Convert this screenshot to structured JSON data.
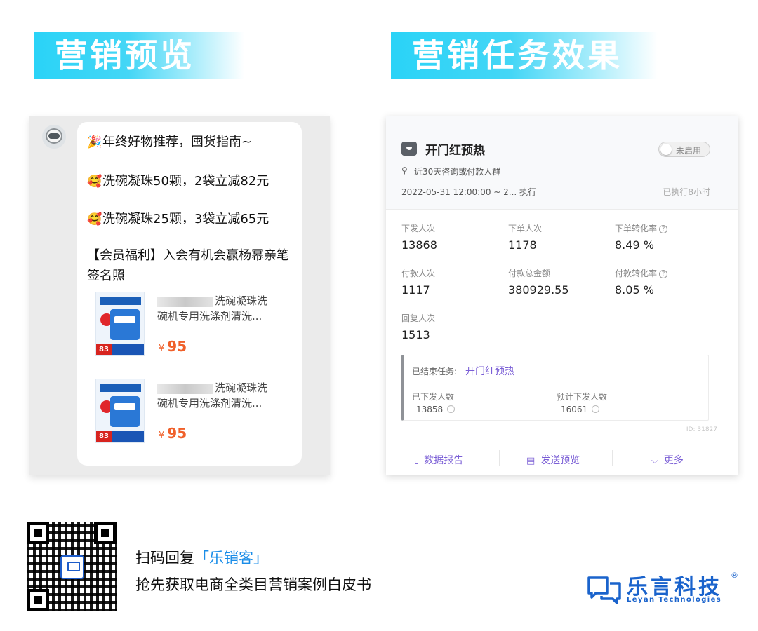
{
  "banners": {
    "left": "营销预览",
    "right": "营销任务效果"
  },
  "chat": {
    "line1_emoji": "🎉",
    "line1": "年终好物推荐，囤货指南~",
    "line2_emoji": "🥰",
    "line2": "洗碗凝珠50颗，2袋立减82元",
    "line3_emoji": "🥰",
    "line3": "洗碗凝珠25颗，3袋立减65元",
    "benefit": "【会员福利】入会有机会赢杨幂亲笔签名照",
    "products": [
      {
        "title_line1": "洗碗凝珠洗",
        "title_line2": "碗机专用洗涤剂清洗...",
        "currency": "¥",
        "price": "95",
        "thumb_tag": "83"
      },
      {
        "title_line1": "洗碗凝珠洗",
        "title_line2": "碗机专用洗涤剂清洗...",
        "currency": "¥",
        "price": "95",
        "thumb_tag": "83"
      }
    ]
  },
  "task": {
    "title": "开门红预热",
    "toggle_label": "未启用",
    "audience": "近30天咨询或付款人群",
    "time_range": "2022-05-31 12:00:00 ~ 2... 执行",
    "executed": "已执行8小时",
    "stats": {
      "sent_label": "下发人次",
      "sent_value": "13868",
      "orders_label": "下单人次",
      "orders_value": "1178",
      "order_rate_label": "下单转化率",
      "order_rate_value": "8.49 %",
      "paid_label": "付款人次",
      "paid_value": "1117",
      "paid_amount_label": "付款总金额",
      "paid_amount_value": "380929.55",
      "pay_rate_label": "付款转化率",
      "pay_rate_value": "8.05 %",
      "reply_label": "回复人次",
      "reply_value": "1513"
    },
    "ended": {
      "label": "已结束任务:",
      "name": "开门红预热",
      "sent_label": "已下发人数",
      "sent_value": "13858",
      "planned_label": "预计下发人数",
      "planned_value": "16061"
    },
    "id_text": "ID: 31827",
    "footer": {
      "report": "数据报告",
      "send_preview": "发送预览",
      "more": "更多"
    }
  },
  "cta": {
    "prefix": "扫码回复",
    "highlight": "「乐销客」",
    "line2": "抢先获取电商全类目营销案例白皮书"
  },
  "brand": {
    "cn": "乐言科技",
    "reg": "®",
    "en": "Leyan Technologies"
  },
  "colors": {
    "banner": "#2ad3f7",
    "accent_purple": "#7b5fd6",
    "price_orange": "#f0602a",
    "brand_blue": "#1a63cc",
    "cta_highlight": "#1a8de8"
  }
}
